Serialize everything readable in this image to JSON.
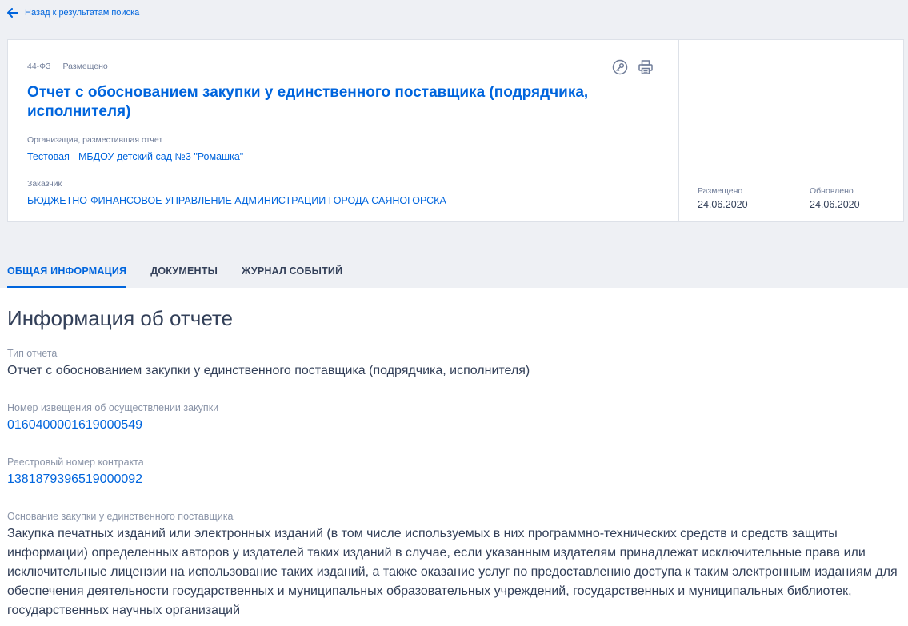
{
  "nav": {
    "back_label": "Назад к результатам поиска"
  },
  "card": {
    "law": "44-ФЗ",
    "status": "Размещено",
    "title": "Отчет с обоснованием закупки у единственного поставщика (подрядчика, исполнителя)",
    "org_label": "Организация, разместившая отчет",
    "org_value": "Тестовая - МБДОУ детский сад №3 \"Ромашка\"",
    "customer_label": "Заказчик",
    "customer_value": "БЮДЖЕТНО-ФИНАНСОВОЕ УПРАВЛЕНИЕ АДМИНИСТРАЦИИ ГОРОДА САЯНОГОРСКА",
    "posted_label": "Размещено",
    "posted_date": "24.06.2020",
    "updated_label": "Обновлено",
    "updated_date": "24.06.2020",
    "icons": [
      "key-icon",
      "print-icon"
    ]
  },
  "tabs": [
    {
      "label": "ОБЩАЯ ИНФОРМАЦИЯ",
      "active": true
    },
    {
      "label": "ДОКУМЕНТЫ",
      "active": false
    },
    {
      "label": "ЖУРНАЛ СОБЫТИЙ",
      "active": false
    }
  ],
  "info": {
    "section_title": "Информация об отчете",
    "type_label": "Тип отчета",
    "type_value": "Отчет с обоснованием закупки у единственного поставщика (подрядчика, исполнителя)",
    "notice_label": "Номер извещения об осуществлении закупки",
    "notice_value": "0160400001619000549",
    "contract_label": "Реестровый номер контракта",
    "contract_value": "1381879396519000092",
    "basis_label": "Основание закупки у единственного поставщика",
    "basis_value": "Закупка печатных изданий или электронных изданий (в том числе используемых в них программно-технических средств и средств защиты информации) определенных авторов у издателей таких изданий в случае, если указанным издателям принадлежат исключительные права или исключительные лицензии на использование таких изданий, а также оказание услуг по предоставлению доступа к таким электронным изданиям для обеспечения деятельности государственных и муниципальных образовательных учреждений, государственных и муниципальных библиотек, государственных научных организаций"
  },
  "colors": {
    "accent": "#0065dd",
    "text": "#334059",
    "muted": "#6f7c98",
    "top_background": "#eef0f4"
  }
}
